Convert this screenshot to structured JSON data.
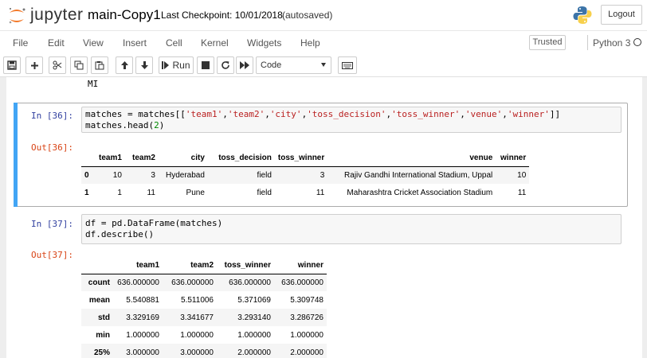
{
  "header": {
    "logo_text": "jupyter",
    "notebook_name": "main-Copy1",
    "checkpoint": "Last Checkpoint: 10/01/2018",
    "autosave_status": "(autosaved)",
    "logout_label": "Logout"
  },
  "menubar": {
    "items": [
      "File",
      "Edit",
      "View",
      "Insert",
      "Cell",
      "Kernel",
      "Widgets",
      "Help"
    ],
    "trusted_label": "Trusted",
    "kernel_name": "Python 3"
  },
  "toolbar": {
    "run_label": "Run",
    "cell_type": "Code",
    "icons": [
      "save-icon",
      "add-cell-icon",
      "cut-icon",
      "copy-icon",
      "paste-icon",
      "move-up-icon",
      "move-down-icon",
      "run-icon",
      "stop-icon",
      "restart-icon",
      "fast-forward-icon",
      "keyboard-icon"
    ]
  },
  "notebook": {
    "previous_output": "MI",
    "cells": [
      {
        "in_prompt": "In [36]:",
        "out_prompt": "Out[36]:",
        "code": [
          "matches = matches[['team1','team2','city','toss_decision','toss_winner','venue','winner']]",
          "matches.head(2)"
        ],
        "table": {
          "columns": [
            "",
            "team1",
            "team2",
            "city",
            "toss_decision",
            "toss_winner",
            "venue",
            "winner"
          ],
          "rows": [
            [
              "0",
              "10",
              "3",
              "Hyderabad",
              "field",
              "3",
              "Rajiv Gandhi International Stadium, Uppal",
              "10"
            ],
            [
              "1",
              "1",
              "11",
              "Pune",
              "field",
              "11",
              "Maharashtra Cricket Association Stadium",
              "11"
            ]
          ]
        }
      },
      {
        "in_prompt": "In [37]:",
        "out_prompt": "Out[37]:",
        "code": [
          "df = pd.DataFrame(matches)",
          "df.describe()"
        ],
        "table": {
          "columns": [
            "",
            "team1",
            "team2",
            "toss_winner",
            "winner"
          ],
          "rows": [
            [
              "count",
              "636.000000",
              "636.000000",
              "636.000000",
              "636.000000"
            ],
            [
              "mean",
              "5.540881",
              "5.511006",
              "5.371069",
              "5.309748"
            ],
            [
              "std",
              "3.329169",
              "3.341677",
              "3.293140",
              "3.286726"
            ],
            [
              "min",
              "1.000000",
              "1.000000",
              "1.000000",
              "1.000000"
            ],
            [
              "25%",
              "3.000000",
              "3.000000",
              "2.000000",
              "2.000000"
            ]
          ]
        }
      }
    ]
  },
  "colors": {
    "selected_cell_bar": "#42a5f5",
    "in_prompt": "#303f9f",
    "out_prompt": "#d84315",
    "string_literal": "#ba2121",
    "number_literal": "#008800",
    "logo_orange": "#f37726"
  }
}
